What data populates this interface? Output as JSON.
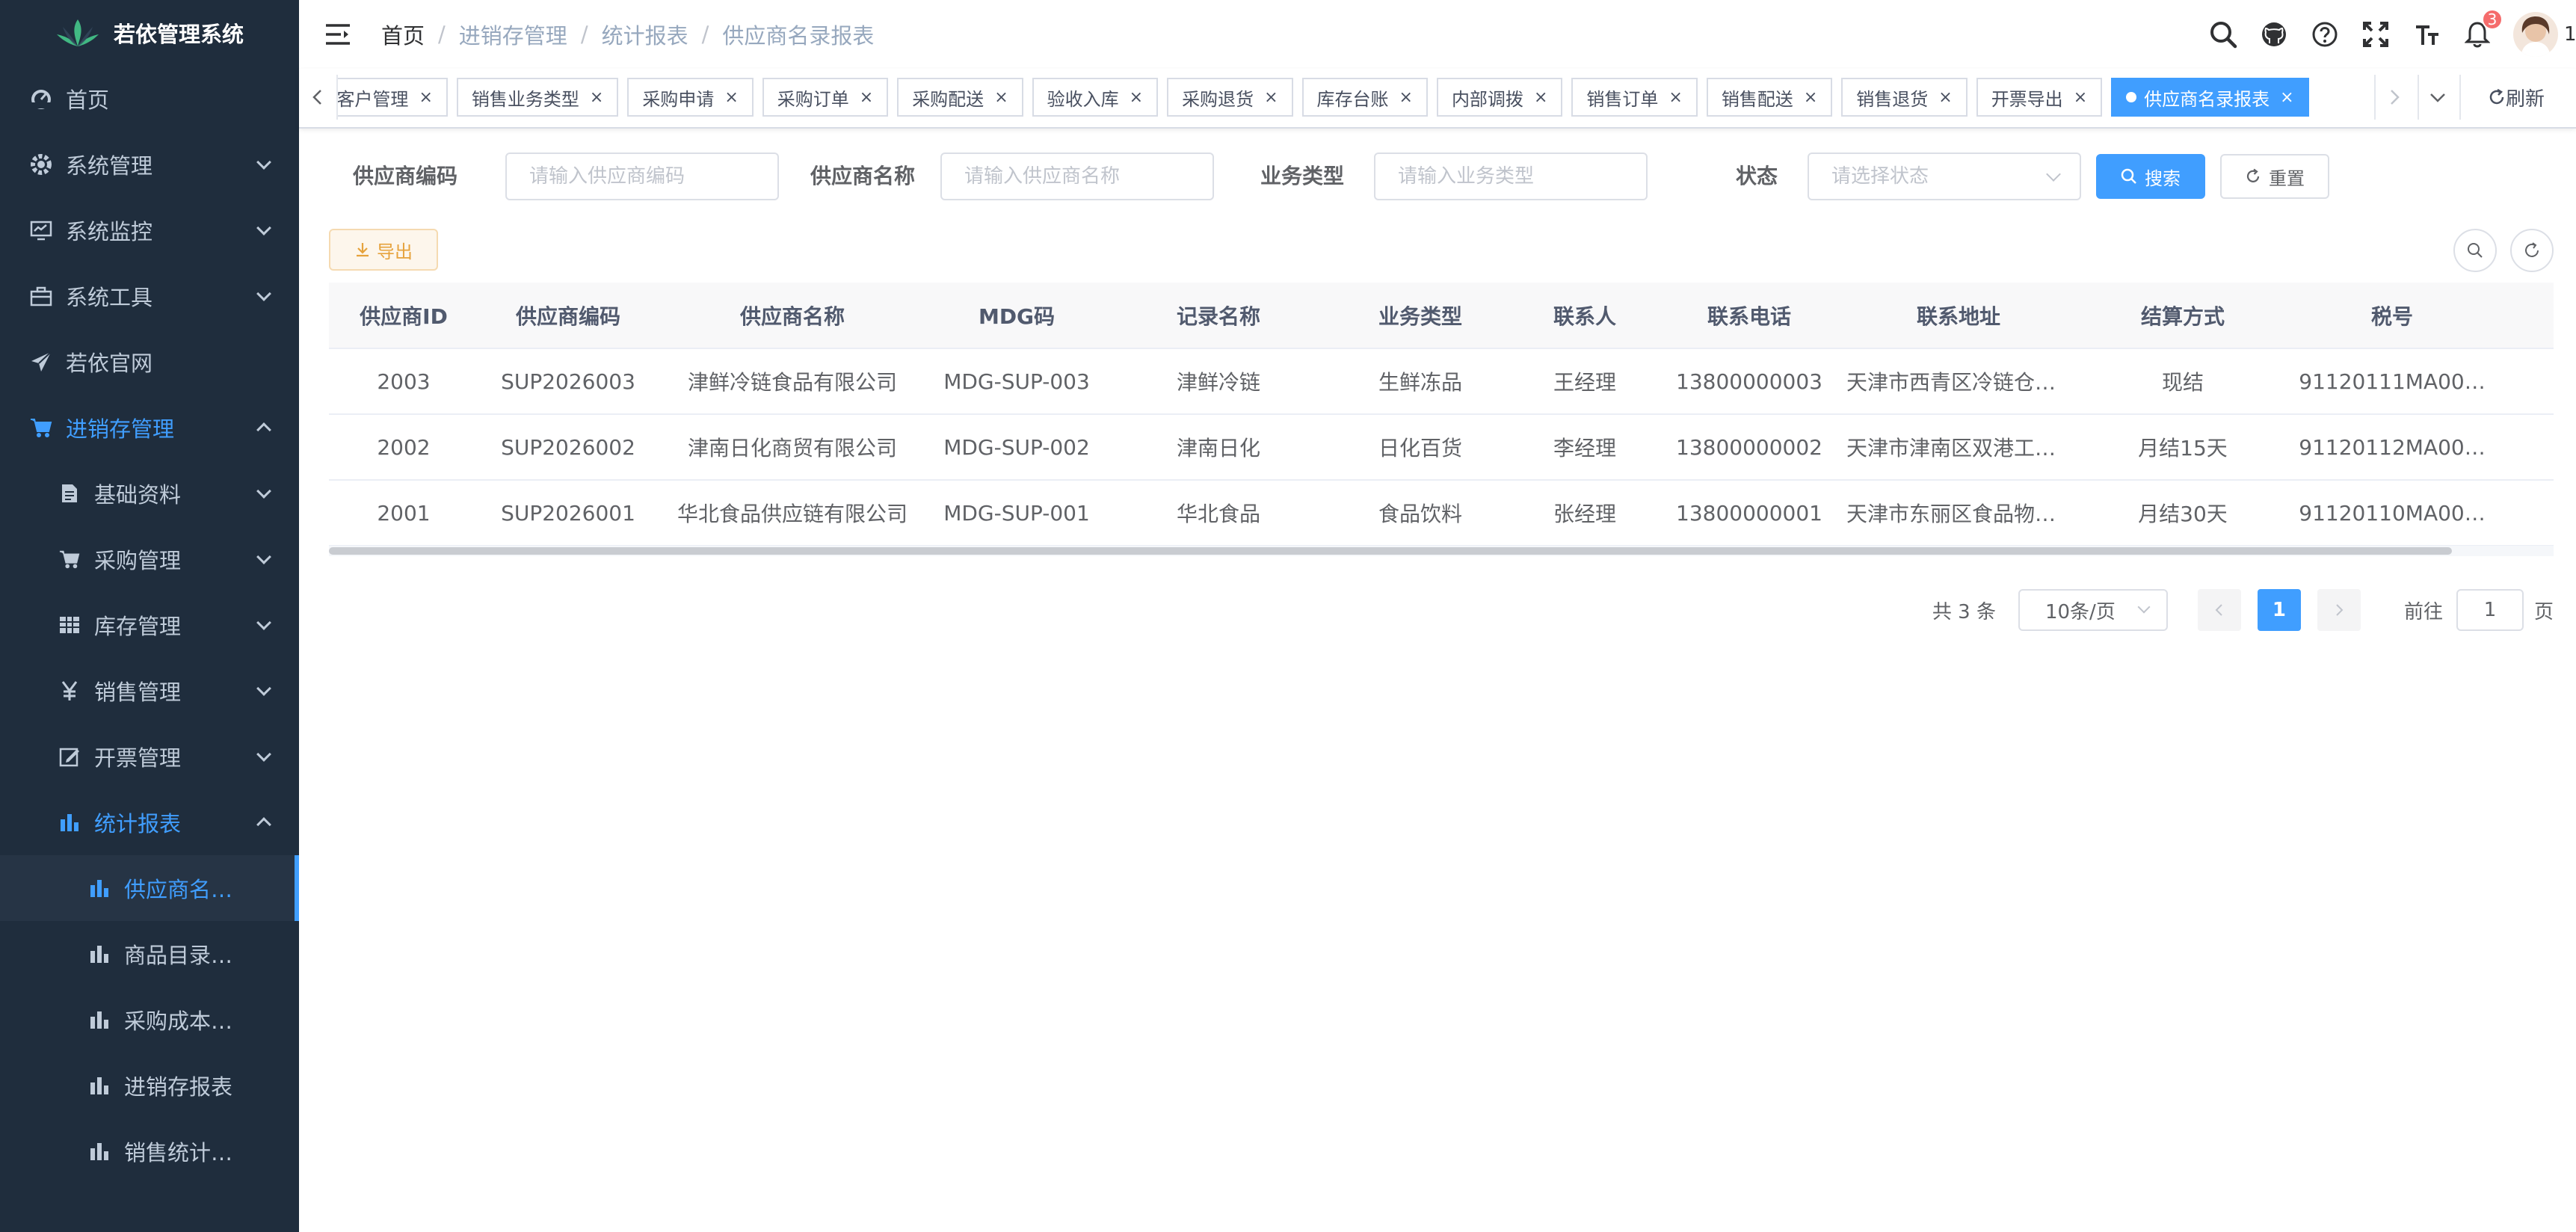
{
  "app": {
    "title": "若依管理系统"
  },
  "sidebar": {
    "items": [
      {
        "label": "首页",
        "icon": "dashboard-icon"
      },
      {
        "label": "系统管理",
        "icon": "gear-icon"
      },
      {
        "label": "系统监控",
        "icon": "monitor-icon"
      },
      {
        "label": "系统工具",
        "icon": "toolbox-icon"
      },
      {
        "label": "若依官网",
        "icon": "paper-plane-icon"
      },
      {
        "label": "进销存管理",
        "icon": "cart-icon"
      }
    ],
    "sub_items": [
      {
        "label": "基础资料",
        "icon": "document-icon"
      },
      {
        "label": "采购管理",
        "icon": "cart-icon"
      },
      {
        "label": "库存管理",
        "icon": "grid-icon"
      },
      {
        "label": "销售管理",
        "icon": "yen-icon"
      },
      {
        "label": "开票管理",
        "icon": "edit-icon"
      },
      {
        "label": "统计报表",
        "icon": "bar-chart-icon"
      }
    ],
    "report_items": [
      {
        "label": "供应商名…",
        "icon": "bar-chart-icon"
      },
      {
        "label": "商品目录…",
        "icon": "bar-chart-icon"
      },
      {
        "label": "采购成本…",
        "icon": "bar-chart-icon"
      },
      {
        "label": "进销存报表",
        "icon": "bar-chart-icon"
      },
      {
        "label": "销售统计…",
        "icon": "bar-chart-icon"
      }
    ]
  },
  "breadcrumb": [
    "首页",
    "进销存管理",
    "统计报表",
    "供应商名录报表"
  ],
  "navbar": {
    "notification_count": "3",
    "avatar_suffix": "1"
  },
  "tags": [
    "理",
    "客户管理",
    "销售业务类型",
    "采购申请",
    "采购订单",
    "采购配送",
    "验收入库",
    "采购退货",
    "库存台账",
    "内部调拨",
    "销售订单",
    "销售配送",
    "销售退货",
    "开票导出"
  ],
  "active_tag": "供应商名录报表",
  "tags_refresh": "刷新",
  "search": {
    "supplier_code_label": "供应商编码",
    "supplier_code_placeholder": "请输入供应商编码",
    "supplier_name_label": "供应商名称",
    "supplier_name_placeholder": "请输入供应商名称",
    "business_type_label": "业务类型",
    "business_type_placeholder": "请输入业务类型",
    "status_label": "状态",
    "status_placeholder": "请选择状态",
    "search_button": "搜索",
    "reset_button": "重置"
  },
  "toolbar": {
    "export_label": "导出"
  },
  "table": {
    "columns": [
      "供应商ID",
      "供应商编码",
      "供应商名称",
      "MDG码",
      "记录名称",
      "业务类型",
      "联系人",
      "联系电话",
      "联系地址",
      "结算方式",
      "税号"
    ],
    "rows": [
      [
        "2003",
        "SUP2026003",
        "津鲜冷链食品有限公司",
        "MDG-SUP-003",
        "津鲜冷链",
        "生鲜冻品",
        "王经理",
        "13800000003",
        "天津市西青区冷链仓储…",
        "现结",
        "91120111MA00…"
      ],
      [
        "2002",
        "SUP2026002",
        "津南日化商贸有限公司",
        "MDG-SUP-002",
        "津南日化",
        "日化百货",
        "李经理",
        "13800000002",
        "天津市津南区双港工业…",
        "月结15天",
        "91120112MA00…"
      ],
      [
        "2001",
        "SUP2026001",
        "华北食品供应链有限公司",
        "MDG-SUP-001",
        "华北食品",
        "食品饮料",
        "张经理",
        "13800000001",
        "天津市东丽区食品物流…",
        "月结30天",
        "91120110MA00…"
      ]
    ]
  },
  "pagination": {
    "total": "共 3 条",
    "page_size": "10条/页",
    "current": "1",
    "goto_label": "前往",
    "goto_value": "1",
    "page_suffix": "页"
  },
  "colors": {
    "sidebar_bg": "#1f2d3d",
    "primary": "#409eff",
    "warning": "#e6a23c"
  }
}
